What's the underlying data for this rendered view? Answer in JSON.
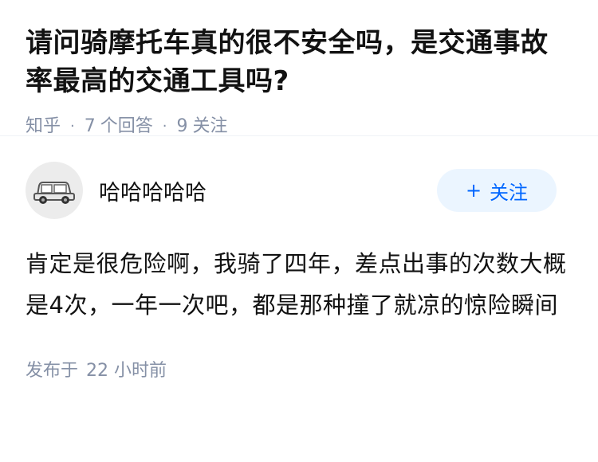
{
  "question": {
    "title": "请问骑摩托车真的很不安全吗，是交通事故率最高的交通工具吗?",
    "source": "知乎",
    "answer_count": "7",
    "answer_label": "个回答",
    "follower_count": "9",
    "follower_label": "关注"
  },
  "answer": {
    "author": "哈哈哈哈哈",
    "avatar_icon": "car-avatar-icon",
    "follow_button": {
      "icon": "+",
      "label": "关注"
    },
    "content": "肯定是很危险啊，我骑了四年，差点出事的次数大概是4次，一年一次吧，都是那种撞了就凉的惊险瞬间",
    "published_label": "发布于",
    "published_time": "22 小时前"
  },
  "colors": {
    "text": "#121212",
    "meta": "#8590a6",
    "accent": "#0066ff",
    "button_bg": "#ebf5ff",
    "divider": "#f0f2f7"
  }
}
